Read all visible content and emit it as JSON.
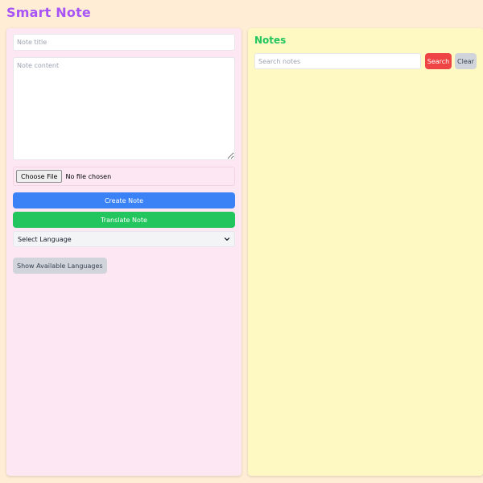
{
  "app": {
    "title": "Smart Note"
  },
  "editor": {
    "title_placeholder": "Note title",
    "title_value": "",
    "content_placeholder": "Note content",
    "content_value": "",
    "file_button_label": "Choose File",
    "file_status": "No file chosen",
    "create_label": "Create Note",
    "translate_label": "Translate Note",
    "language_selected": "Select Language",
    "show_languages_label": "Show Available Languages"
  },
  "notes": {
    "heading": "Notes",
    "search_placeholder": "Search notes",
    "search_value": "",
    "search_label": "Search",
    "clear_label": "Clear",
    "items": []
  },
  "colors": {
    "page_background": "#ffedd5",
    "title": "#a855f7",
    "editor_panel": "#fce7f3",
    "notes_panel": "#fef9c3",
    "create_button": "#3b82f6",
    "translate_button": "#22c55e",
    "notes_heading": "#22c55e",
    "search_button": "#ef4444",
    "clear_button": "#d1d5db"
  }
}
